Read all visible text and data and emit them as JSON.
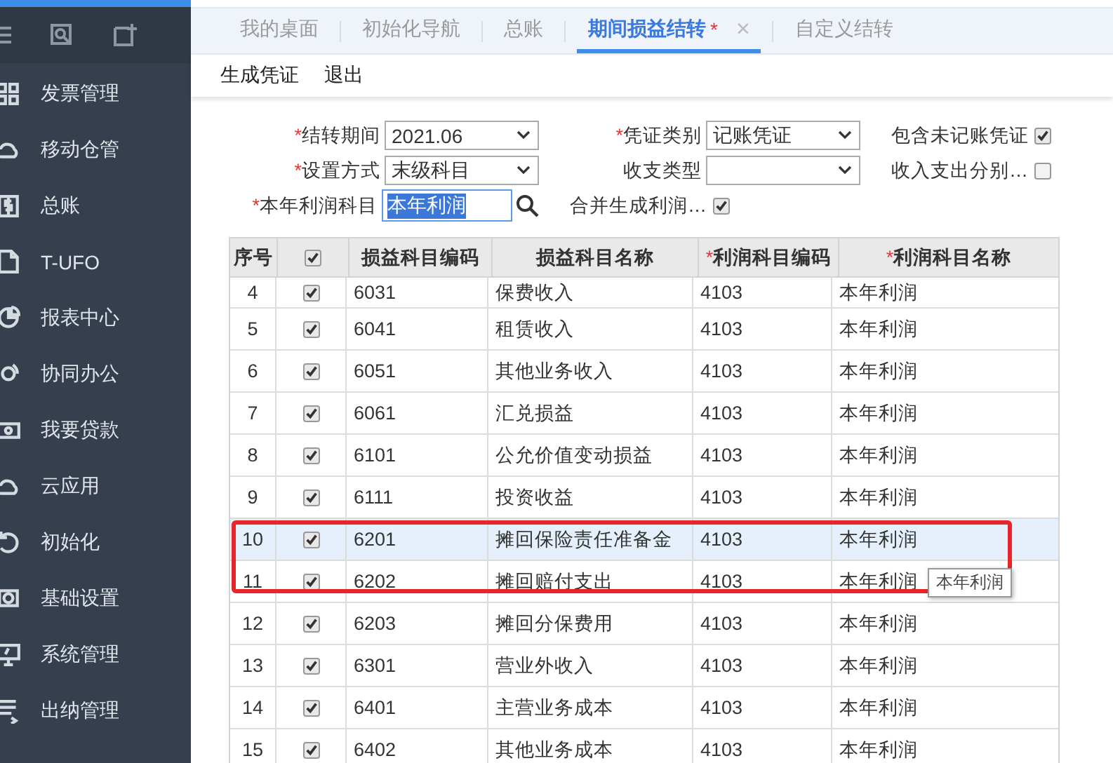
{
  "sidebar": {
    "items": [
      {
        "label": "发票管理"
      },
      {
        "label": "移动仓管"
      },
      {
        "label": "总账"
      },
      {
        "label": "T-UFO"
      },
      {
        "label": "报表中心"
      },
      {
        "label": "协同办公"
      },
      {
        "label": "我要贷款"
      },
      {
        "label": "云应用"
      },
      {
        "label": "初始化"
      },
      {
        "label": "基础设置"
      },
      {
        "label": "系统管理"
      },
      {
        "label": "出纳管理"
      }
    ]
  },
  "tabs": [
    {
      "label": "我的桌面",
      "selected": false
    },
    {
      "label": "初始化导航",
      "selected": false
    },
    {
      "label": "总账",
      "selected": false
    },
    {
      "label": "期间损益结转",
      "selected": true,
      "mark": "*",
      "close": "×"
    },
    {
      "label": "自定义结转",
      "selected": false
    }
  ],
  "toolbar": [
    "生成凭证",
    "退出"
  ],
  "form": {
    "fields": [
      {
        "kind": "select",
        "label": "结转期间",
        "mark": "*",
        "value": "2021.06"
      },
      {
        "kind": "select",
        "label": "凭证类别",
        "mark": "*",
        "value": "记账凭证"
      },
      {
        "kind": "checkbox",
        "label": "包含未记账凭证",
        "checked": true
      },
      {
        "kind": "select",
        "label": "设置方式",
        "mark": "*",
        "value": "末级科目"
      },
      {
        "kind": "select",
        "label": "收支类型"
      },
      {
        "kind": "checkbox",
        "label": "收入支出分别…",
        "checked": false
      },
      {
        "kind": "search",
        "label": "本年利润科目",
        "mark": "*",
        "value": "本年利润",
        "text_selected": true
      },
      {
        "kind": "checkbox",
        "label": "合并生成利润…",
        "checked": true
      }
    ]
  },
  "table": {
    "all_checked": true,
    "columns": [
      {
        "label": "序号"
      },
      {
        "kind": "checkbox"
      },
      {
        "label": "损益科目编码"
      },
      {
        "label": "损益科目名称"
      },
      {
        "label": "利润科目编码",
        "mark": "*"
      },
      {
        "label": "利润科目名称",
        "mark": "*"
      }
    ],
    "rows": [
      {
        "no": "4",
        "checked": true,
        "code": "6031",
        "name": "保费收入",
        "profit_code": "4103",
        "profit_name": "本年利润",
        "selected": false
      },
      {
        "no": "5",
        "checked": true,
        "code": "6041",
        "name": "租赁收入",
        "profit_code": "4103",
        "profit_name": "本年利润",
        "selected": false
      },
      {
        "no": "6",
        "checked": true,
        "code": "6051",
        "name": "其他业务收入",
        "profit_code": "4103",
        "profit_name": "本年利润",
        "selected": false
      },
      {
        "no": "7",
        "checked": true,
        "code": "6061",
        "name": "汇兑损益",
        "profit_code": "4103",
        "profit_name": "本年利润",
        "selected": false
      },
      {
        "no": "8",
        "checked": true,
        "code": "6101",
        "name": "公允价值变动损益",
        "profit_code": "4103",
        "profit_name": "本年利润",
        "selected": false
      },
      {
        "no": "9",
        "checked": true,
        "code": "6111",
        "name": "投资收益",
        "profit_code": "4103",
        "profit_name": "本年利润",
        "selected": false
      },
      {
        "no": "10",
        "checked": true,
        "code": "6201",
        "name": "摊回保险责任准备金",
        "profit_code": "4103",
        "profit_name": "本年利润",
        "selected": true
      },
      {
        "no": "11",
        "checked": true,
        "code": "6202",
        "name": "摊回赔付支出",
        "profit_code": "4103",
        "profit_name": "本年利润",
        "selected": false
      },
      {
        "no": "12",
        "checked": true,
        "code": "6203",
        "name": "摊回分保费用",
        "profit_code": "4103",
        "profit_name": "本年利润",
        "selected": false
      },
      {
        "no": "13",
        "checked": true,
        "code": "6301",
        "name": "营业外收入",
        "profit_code": "4103",
        "profit_name": "本年利润",
        "selected": false
      },
      {
        "no": "14",
        "checked": true,
        "code": "6401",
        "name": "主营业务成本",
        "profit_code": "4103",
        "profit_name": "本年利润",
        "selected": false
      },
      {
        "no": "15",
        "checked": true,
        "code": "6402",
        "name": "其他业务成本",
        "profit_code": "4103",
        "profit_name": "本年利润",
        "selected": false
      }
    ],
    "tooltip": "本年利润"
  }
}
